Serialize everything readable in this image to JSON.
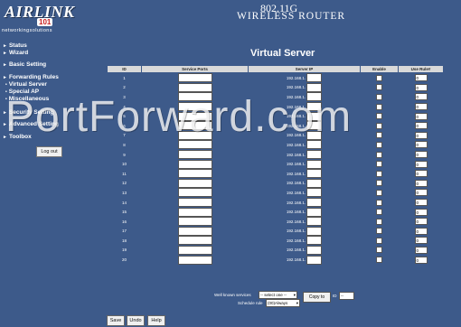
{
  "header": {
    "logo_word": "AIRLINK",
    "logo_num": "101",
    "tagline": "networkingsolutions",
    "model": "802.11G",
    "product": "WIRELESS ROUTER"
  },
  "sidebar": {
    "items": [
      {
        "label": "Status"
      },
      {
        "label": "Wizard"
      },
      {
        "label": "Basic Setting"
      },
      {
        "label": "Forwarding Rules"
      },
      {
        "label": "Virtual Server"
      },
      {
        "label": "Special AP"
      },
      {
        "label": "Miscellaneous"
      },
      {
        "label": "Security Setting"
      },
      {
        "label": "Advanced Setting"
      },
      {
        "label": "Toolbox"
      }
    ],
    "logout_label": "Log out"
  },
  "main": {
    "title": "Virtual Server",
    "columns": [
      "ID",
      "Service Ports",
      "Server IP",
      "Enable",
      "Use Rule#"
    ],
    "ip_prefix": "192.168.1.",
    "rows": [
      {
        "id": "1",
        "rule": "0"
      },
      {
        "id": "2",
        "rule": "0"
      },
      {
        "id": "3",
        "rule": "0"
      },
      {
        "id": "4",
        "rule": "0"
      },
      {
        "id": "5",
        "rule": "0"
      },
      {
        "id": "6",
        "rule": "0"
      },
      {
        "id": "7",
        "rule": "0"
      },
      {
        "id": "8",
        "rule": "0"
      },
      {
        "id": "9",
        "rule": "0"
      },
      {
        "id": "10",
        "rule": "0"
      },
      {
        "id": "11",
        "rule": "0"
      },
      {
        "id": "12",
        "rule": "0"
      },
      {
        "id": "13",
        "rule": "0"
      },
      {
        "id": "14",
        "rule": "0"
      },
      {
        "id": "15",
        "rule": "0"
      },
      {
        "id": "16",
        "rule": "0"
      },
      {
        "id": "17",
        "rule": "0"
      },
      {
        "id": "18",
        "rule": "0"
      },
      {
        "id": "19",
        "rule": "0"
      },
      {
        "id": "20",
        "rule": "0"
      }
    ]
  },
  "bottom": {
    "well_known_label": "Well known services",
    "well_known_value": "-- select one --",
    "schedule_label": "Schedule rule",
    "schedule_value": "(00)Always",
    "copy_label": "Copy to",
    "id_label": "ID",
    "id_value": "--"
  },
  "buttons": {
    "save": "Save",
    "undo": "Undo",
    "help": "Help"
  },
  "watermark": "PortForward.com"
}
